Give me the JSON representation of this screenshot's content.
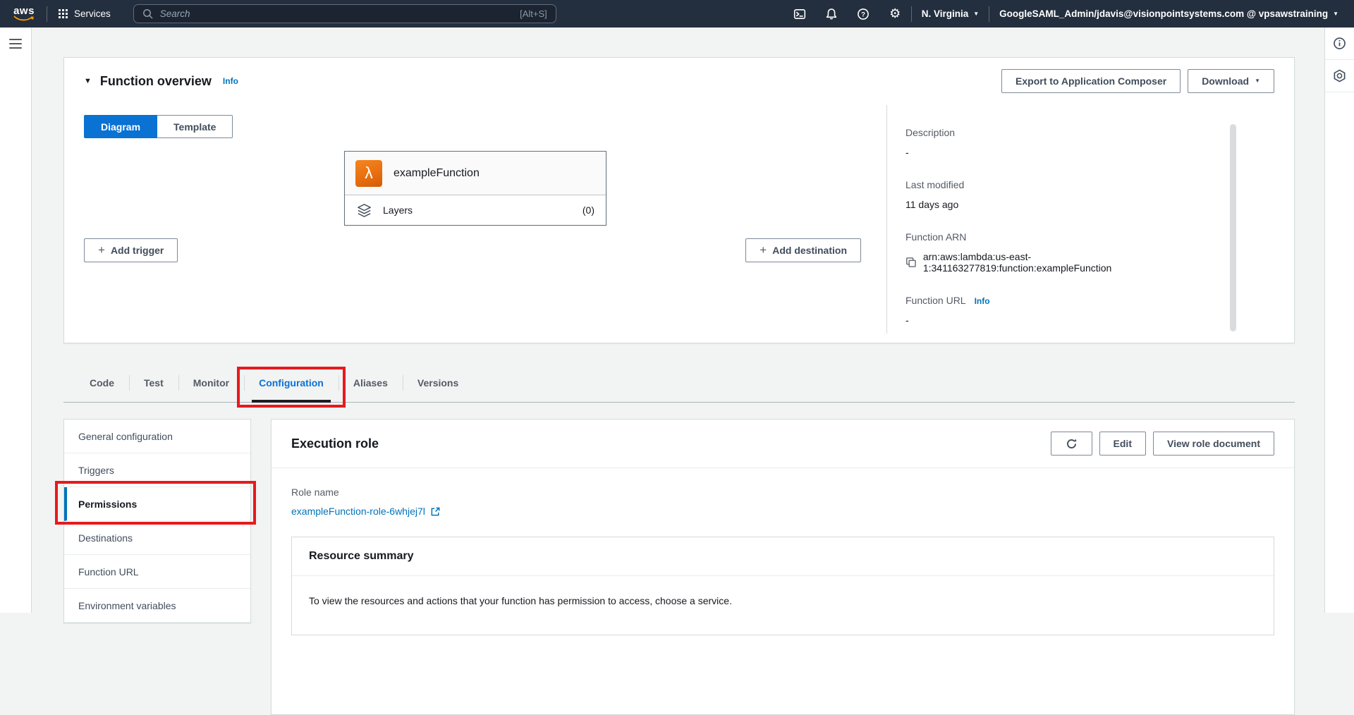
{
  "topnav": {
    "logo": "aws",
    "services_label": "Services",
    "search_placeholder": "Search",
    "search_shortcut": "[Alt+S]",
    "region_label": "N. Virginia",
    "account_label": "GoogleSAML_Admin/jdavis@visionpointsystems.com @ vpsawstraining"
  },
  "icons": {
    "caret_down": "▼",
    "collapse_caret": "▼",
    "plus": "+",
    "lambda": "λ",
    "gear": "⚙"
  },
  "colors": {
    "nav_bg": "#232f3e",
    "accent_blue": "#0972d3",
    "link_blue": "#0073bb",
    "annotation_red": "#e8191c",
    "selected_tab_underline": "#1a1f26",
    "lambda_orange": "#e86f10",
    "page_bg": "#f2f3f3"
  },
  "overview": {
    "title": "Function overview",
    "info_label": "Info",
    "export_button": "Export to Application Composer",
    "download_button": "Download",
    "view_toggle": {
      "diagram_label": "Diagram",
      "template_label": "Template",
      "selected": "Diagram"
    },
    "diagram": {
      "function_name": "exampleFunction",
      "layers_label": "Layers",
      "layers_count": "(0)",
      "add_trigger_button": "Add trigger",
      "add_destination_button": "Add destination"
    },
    "details": {
      "description_label": "Description",
      "description_value": "-",
      "last_modified_label": "Last modified",
      "last_modified_value": "11 days ago",
      "function_arn_label": "Function ARN",
      "function_arn_value": "arn:aws:lambda:us-east-1:341163277819:function:exampleFunction",
      "function_url_label": "Function URL",
      "function_url_info": "Info",
      "function_url_value": "-"
    }
  },
  "tabs": [
    {
      "label": "Code",
      "selected": false
    },
    {
      "label": "Test",
      "selected": false
    },
    {
      "label": "Monitor",
      "selected": false
    },
    {
      "label": "Configuration",
      "selected": true,
      "annotated": true
    },
    {
      "label": "Aliases",
      "selected": false
    },
    {
      "label": "Versions",
      "selected": false
    }
  ],
  "config_nav": {
    "items": [
      {
        "label": "General configuration",
        "selected": false
      },
      {
        "label": "Triggers",
        "selected": false
      },
      {
        "label": "Permissions",
        "selected": true,
        "annotated": true
      },
      {
        "label": "Destinations",
        "selected": false
      },
      {
        "label": "Function URL",
        "selected": false
      },
      {
        "label": "Environment variables",
        "selected": false
      }
    ]
  },
  "execution_role": {
    "title": "Execution role",
    "edit_button": "Edit",
    "view_role_button": "View role document",
    "role_name_label": "Role name",
    "role_name_link": "exampleFunction-role-6whjej7l",
    "resource_summary": {
      "title": "Resource summary",
      "body": "To view the resources and actions that your function has permission to access, choose a service."
    }
  }
}
